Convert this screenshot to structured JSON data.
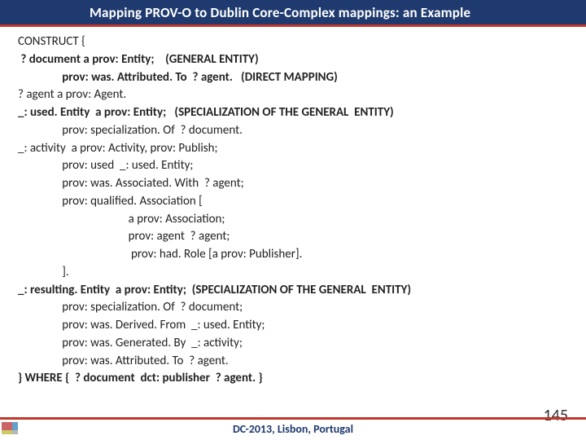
{
  "title": "Mapping PROV-O to Dublin Core-Complex mappings: an Example",
  "lines": [
    {
      "text": "CONSTRUCT {",
      "bold": false,
      "indent": 0
    },
    {
      "text": " ? document a prov: Entity;    (GENERAL ENTITY)",
      "bold": true,
      "indent": 0
    },
    {
      "text": "prov: was. Attributed. To  ? agent.   (DIRECT MAPPING)",
      "bold": true,
      "indent": 2
    },
    {
      "text": "? agent a prov: Agent.",
      "bold": false,
      "indent": 0
    },
    {
      "text": "_: used. Entity  a prov: Entity;   (SPECIALIZATION OF THE GENERAL  ENTITY)",
      "bold": true,
      "indent": 0
    },
    {
      "text": "prov: specialization. Of  ? document.",
      "bold": false,
      "indent": 2
    },
    {
      "text": "_: activity  a prov: Activity, prov: Publish;",
      "bold": false,
      "indent": 0
    },
    {
      "text": "prov: used  _: used. Entity;",
      "bold": false,
      "indent": 2
    },
    {
      "text": "prov: was. Associated. With  ? agent;",
      "bold": false,
      "indent": 2
    },
    {
      "text": "prov: qualified. Association [",
      "bold": false,
      "indent": 2
    },
    {
      "text": "a prov: Association;",
      "bold": false,
      "indent": 5
    },
    {
      "text": "prov: agent  ? agent;",
      "bold": false,
      "indent": 5
    },
    {
      "text": " prov: had. Role [a prov: Publisher].",
      "bold": false,
      "indent": 5
    },
    {
      "text": "].",
      "bold": false,
      "indent": 2
    },
    {
      "text": "_: resulting. Entity  a prov: Entity;  (SPECIALIZATION OF THE GENERAL  ENTITY)",
      "bold": true,
      "indent": 0
    },
    {
      "text": "prov: specialization. Of  ? document;",
      "bold": false,
      "indent": 2
    },
    {
      "text": "prov: was. Derived. From  _: used. Entity;",
      "bold": false,
      "indent": 2
    },
    {
      "text": "prov: was. Generated. By  _: activity;",
      "bold": false,
      "indent": 2
    },
    {
      "text": "prov: was. Attributed. To  ? agent.",
      "bold": false,
      "indent": 2
    },
    {
      "text": "} WHERE {  ? document  dct: publisher  ? agent. }",
      "bold": true,
      "indent": 0
    }
  ],
  "footer": "DC-2013, Lisbon, Portugal",
  "page": "145"
}
